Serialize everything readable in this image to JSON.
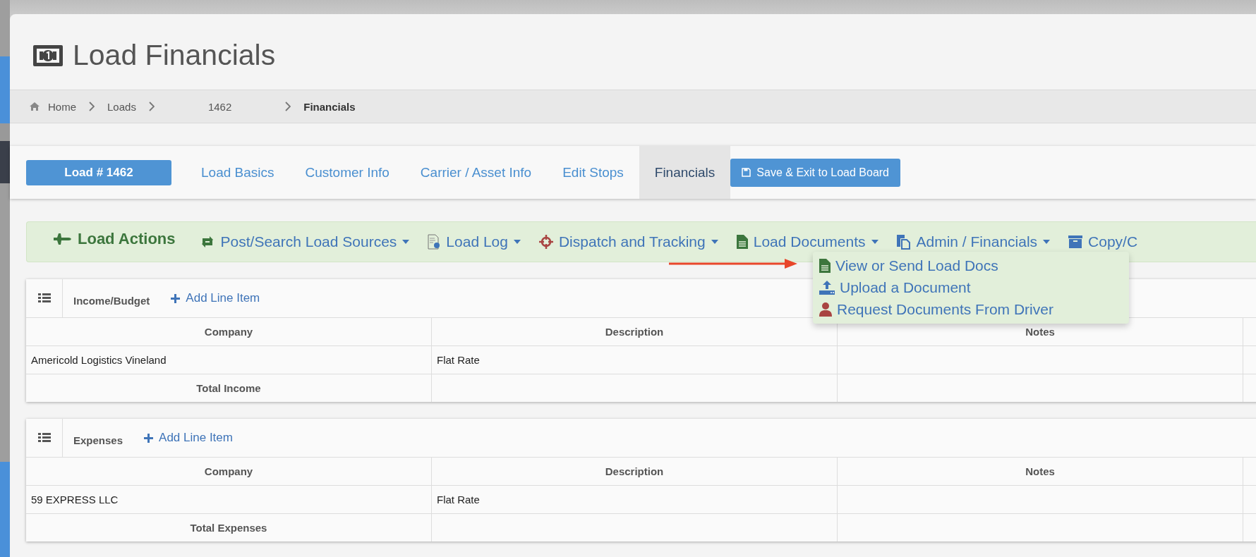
{
  "page": {
    "title": "Load Financials"
  },
  "breadcrumbs": [
    {
      "label": "Home",
      "kind": "home"
    },
    {
      "label": "Loads",
      "kind": "link"
    },
    {
      "label": "1462",
      "kind": "load"
    },
    {
      "label": "Financials",
      "kind": "current"
    }
  ],
  "load_button": "Load # 1462",
  "tabs": [
    {
      "label": "Load Basics",
      "selected": false
    },
    {
      "label": "Customer Info",
      "selected": false
    },
    {
      "label": "Carrier / Asset Info",
      "selected": false
    },
    {
      "label": "Edit Stops",
      "selected": false
    },
    {
      "label": "Financials",
      "selected": true
    }
  ],
  "save_button": "Save & Exit to Load Board",
  "load_actions": {
    "title": "Load Actions",
    "menus": [
      {
        "label": "Post/Search Load Sources",
        "kind": "sources",
        "caret": true,
        "expanded": false
      },
      {
        "label": "Load Log",
        "kind": "log",
        "caret": true,
        "expanded": false
      },
      {
        "label": "Dispatch and Tracking",
        "kind": "dispatch",
        "caret": true,
        "expanded": false
      },
      {
        "label": "Load Documents",
        "kind": "documents",
        "caret": true,
        "expanded": true,
        "items": [
          {
            "label": "View or Send Load Docs",
            "kind": "view"
          },
          {
            "label": "Upload a Document",
            "kind": "upload"
          },
          {
            "label": "Request Documents From Driver",
            "kind": "request"
          }
        ]
      },
      {
        "label": "Admin / Financials",
        "kind": "admin",
        "caret": true,
        "expanded": false
      },
      {
        "label": "Copy/C",
        "kind": "copy",
        "caret": false,
        "expanded": false
      }
    ]
  },
  "sections": [
    {
      "title": "Income/Budget",
      "add_label": "Add Line Item",
      "columns": [
        "Company",
        "Description",
        "Notes"
      ],
      "rows": [
        {
          "cells": [
            "Americold Logistics Vineland",
            "Flat Rate"
          ]
        }
      ],
      "total_label": "Total Income"
    },
    {
      "title": "Expenses",
      "add_label": "Add Line Item",
      "columns": [
        "Company",
        "Description",
        "Notes"
      ],
      "rows": [
        {
          "cells": [
            "59 EXPRESS LLC",
            "Flat Rate"
          ]
        }
      ],
      "total_label": "Total Expenses"
    }
  ]
}
